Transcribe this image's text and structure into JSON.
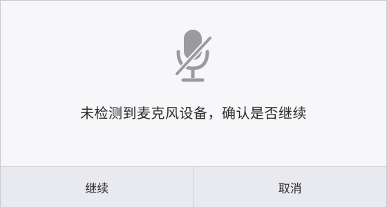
{
  "dialog": {
    "icon": "microphone-muted-icon",
    "message": "未检测到麦克风设备，确认是否继续",
    "buttons": {
      "continue_label": "继续",
      "cancel_label": "取消"
    }
  },
  "colors": {
    "background": "#f7f6f9",
    "icon": "#9b9b9f",
    "text": "#2d2d2d",
    "button_bar": "#e9e9f0"
  }
}
